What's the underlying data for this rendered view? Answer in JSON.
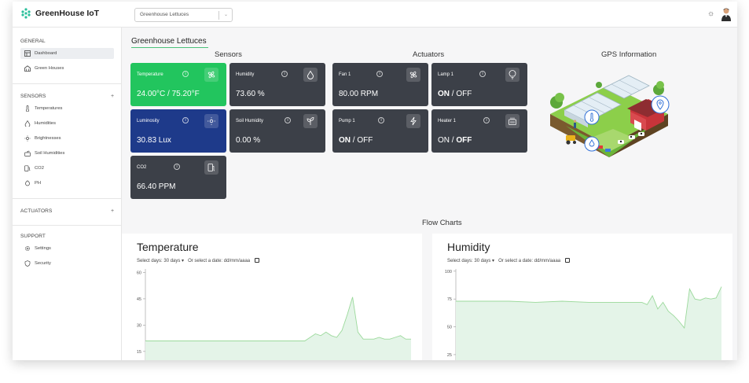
{
  "app": {
    "title": "GreenHouse IoT"
  },
  "header": {
    "greenhouse_select": "Greenhouse Lettuces"
  },
  "sidebar": {
    "general_title": "GENERAL",
    "general_items": [
      {
        "label": "Dashboard",
        "icon": "dashboard-icon",
        "active": true
      },
      {
        "label": "Green Houses",
        "icon": "greenhouse-icon",
        "active": false
      }
    ],
    "sensors_title": "SENSORS",
    "sensors_toggle": "+",
    "sensor_items": [
      {
        "label": "Temperatures",
        "icon": "thermometer-icon"
      },
      {
        "label": "Humidities",
        "icon": "droplet-icon"
      },
      {
        "label": "Brightnesses",
        "icon": "sun-icon"
      },
      {
        "label": "Soil Humidities",
        "icon": "soil-icon"
      },
      {
        "label": "CO2",
        "icon": "co2-icon"
      },
      {
        "label": "PH",
        "icon": "ph-icon"
      }
    ],
    "actuators_title": "ACTUATORS",
    "actuators_toggle": "+",
    "support_title": "SUPPORT",
    "support_items": [
      {
        "label": "Settings",
        "icon": "gear-icon"
      },
      {
        "label": "Security",
        "icon": "shield-icon"
      }
    ]
  },
  "main": {
    "greenhouse_title": "Greenhouse Lettuces",
    "sensors_header": "Sensors",
    "actuators_header": "Actuators",
    "gps_header": "GPS Information",
    "sensor_cards": [
      {
        "label": "Temperature",
        "value": "24.00°C / 75.20°F",
        "color": "#22c55e",
        "icon": "fan-icon"
      },
      {
        "label": "Humidity",
        "value": "73.60 %",
        "color": "#3c4048",
        "icon": "droplet-icon"
      },
      {
        "label": "Luminosity",
        "value": "30.83 Lux",
        "color": "#1e3a8a",
        "icon": "sun-icon"
      },
      {
        "label": "Soil Humidity",
        "value": "0.00 %",
        "color": "#3c4048",
        "icon": "plant-icon"
      },
      {
        "label": "CO2",
        "value": "66.40 PPM",
        "color": "#3c4048",
        "icon": "fuel-icon"
      }
    ],
    "actuator_cards": [
      {
        "label": "Fan 1",
        "value": "80.00 RPM",
        "icon": "fan-icon"
      },
      {
        "label": "Lamp 1",
        "value_on": "ON",
        "value_sep": " / ",
        "value_off": "OFF",
        "state": "on",
        "icon": "bulb-icon"
      },
      {
        "label": "Pump 1",
        "value_on": "ON",
        "value_sep": " / ",
        "value_off": "OFF",
        "state": "on",
        "icon": "pump-icon"
      },
      {
        "label": "Heater 1",
        "value_on": "ON",
        "value_sep": " / ",
        "value_off": "OFF",
        "state": "off",
        "icon": "heater-icon"
      }
    ],
    "flow_charts_title": "Flow Charts"
  },
  "chart_data": [
    {
      "type": "area",
      "title": "Temperature",
      "select_label": "Select days:",
      "select_value": "30 days",
      "date_label": "Or select a date:",
      "date_placeholder": "dd/mm/aaaa",
      "y_ticks": [
        60,
        45,
        30,
        15
      ],
      "ylim": [
        10,
        62
      ],
      "x": [
        0,
        10,
        20,
        30,
        40,
        50,
        60,
        62,
        64,
        66,
        68,
        70,
        72,
        74,
        76,
        78,
        80,
        82,
        84,
        86,
        88,
        90,
        92,
        94,
        96,
        98,
        100
      ],
      "series": [
        {
          "values": [
            21,
            21,
            21,
            21,
            21,
            21,
            21,
            23,
            25,
            24,
            26,
            24,
            23,
            27,
            36,
            46,
            26,
            22,
            22,
            22,
            23,
            22,
            22,
            23,
            24,
            22,
            22
          ]
        }
      ],
      "color": "#9bd99b"
    },
    {
      "type": "area",
      "title": "Humidity",
      "select_label": "Select days:",
      "select_value": "30 days",
      "date_label": "Or select a date:",
      "date_placeholder": "dd/mm/aaaa",
      "y_ticks": [
        100,
        75,
        50,
        25
      ],
      "ylim": [
        20,
        102
      ],
      "x": [
        0,
        10,
        20,
        30,
        40,
        50,
        60,
        65,
        70,
        72,
        74,
        76,
        78,
        80,
        82,
        84,
        86,
        88,
        90,
        92,
        94,
        96,
        98,
        100
      ],
      "series": [
        {
          "values": [
            73,
            73,
            73,
            72,
            73,
            72,
            72,
            72,
            72,
            70,
            78,
            66,
            72,
            64,
            60,
            55,
            49,
            84,
            75,
            74,
            76,
            75,
            76,
            86
          ]
        }
      ],
      "color": "#9bd99b"
    }
  ]
}
